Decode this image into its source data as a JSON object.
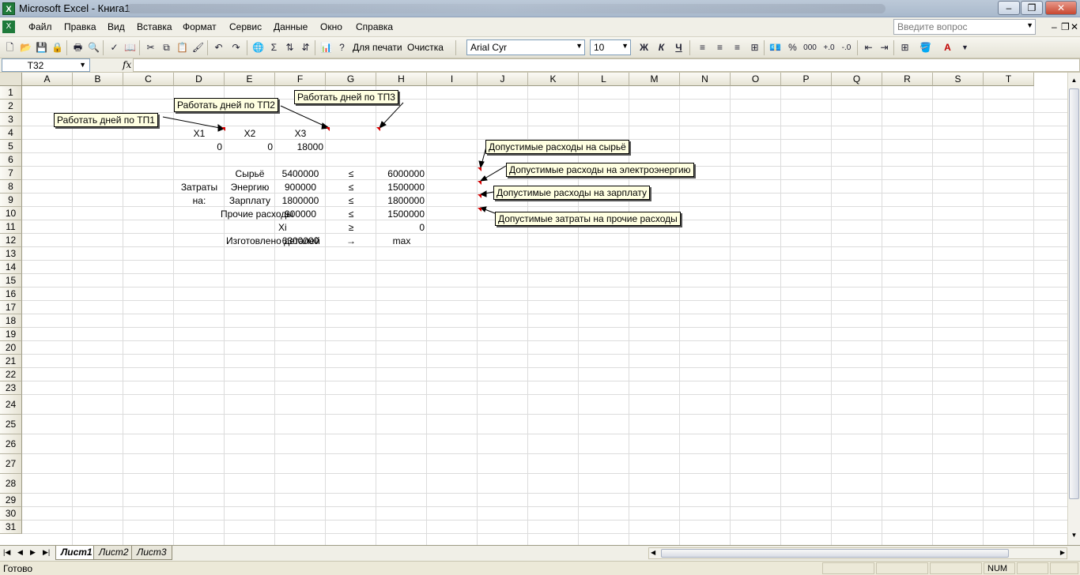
{
  "window": {
    "app_title": "Microsoft Excel - Книга1",
    "excel_icon_letter": "X"
  },
  "menu": {
    "items": [
      "Файл",
      "Правка",
      "Вид",
      "Вставка",
      "Формат",
      "Сервис",
      "Данные",
      "Окно",
      "Справка"
    ],
    "ask_placeholder": "Введите вопрос"
  },
  "toolbar": {
    "print_label": "Для печати",
    "clear_label": "Очистка",
    "font_name": "Arial Cyr",
    "font_size": "10",
    "bold_label": "Ж",
    "italic_label": "К",
    "underline_label": "Ч",
    "percent_label": "%",
    "thousands_label": "000"
  },
  "formula": {
    "name_box": "T32",
    "fx_label": "fx",
    "content": ""
  },
  "grid": {
    "columns": [
      "A",
      "B",
      "C",
      "D",
      "E",
      "F",
      "G",
      "H",
      "I",
      "J",
      "K",
      "L",
      "M",
      "N",
      "O",
      "P",
      "Q",
      "R",
      "S",
      "T"
    ],
    "rows": [
      "1",
      "2",
      "3",
      "4",
      "5",
      "6",
      "7",
      "8",
      "9",
      "10",
      "11",
      "12",
      "13",
      "14",
      "15",
      "16",
      "17",
      "18",
      "19",
      "20",
      "21",
      "22",
      "23",
      "24",
      "25",
      "26",
      "27",
      "28",
      "29",
      "30",
      "31"
    ]
  },
  "cells": {
    "d4": "X1",
    "e4": "X2",
    "f4": "X3",
    "d5": "0",
    "e5": "0",
    "f5": "18000",
    "d8": "Затраты",
    "d9": "на:",
    "e7": "Сырьё",
    "e8": "Энергию",
    "e9": "Зарплату",
    "e10": "Прочие расходы",
    "f7": "5400000",
    "f8": "900000",
    "f9": "1800000",
    "f10": "900000",
    "f11": "Xi",
    "g7": "≤",
    "g8": "≤",
    "g9": "≤",
    "g10": "≤",
    "g11": "≥",
    "h7": "6000000",
    "h8": "1500000",
    "h9": "1800000",
    "h10": "1500000",
    "h11": "0",
    "e12": "Изготовлено деталей",
    "f12": "6300000",
    "g12": "→",
    "h12": "max"
  },
  "comments": {
    "tp1": "Работать дней по ТП1",
    "tp2": "Работать дней по ТП2",
    "tp3": "Работать дней по ТП3",
    "raw": "Допустимые расходы на сырьё",
    "energy": "Допустимые расходы на электроэнергию",
    "salary": "Допустимые расходы на зарплату",
    "other": "Допустимые затраты на прочие расходы"
  },
  "sheets": {
    "tabs": [
      "Лист1",
      "Лист2",
      "Лист3"
    ],
    "active": "Лист1"
  },
  "status": {
    "ready": "Готово",
    "num": "NUM"
  }
}
